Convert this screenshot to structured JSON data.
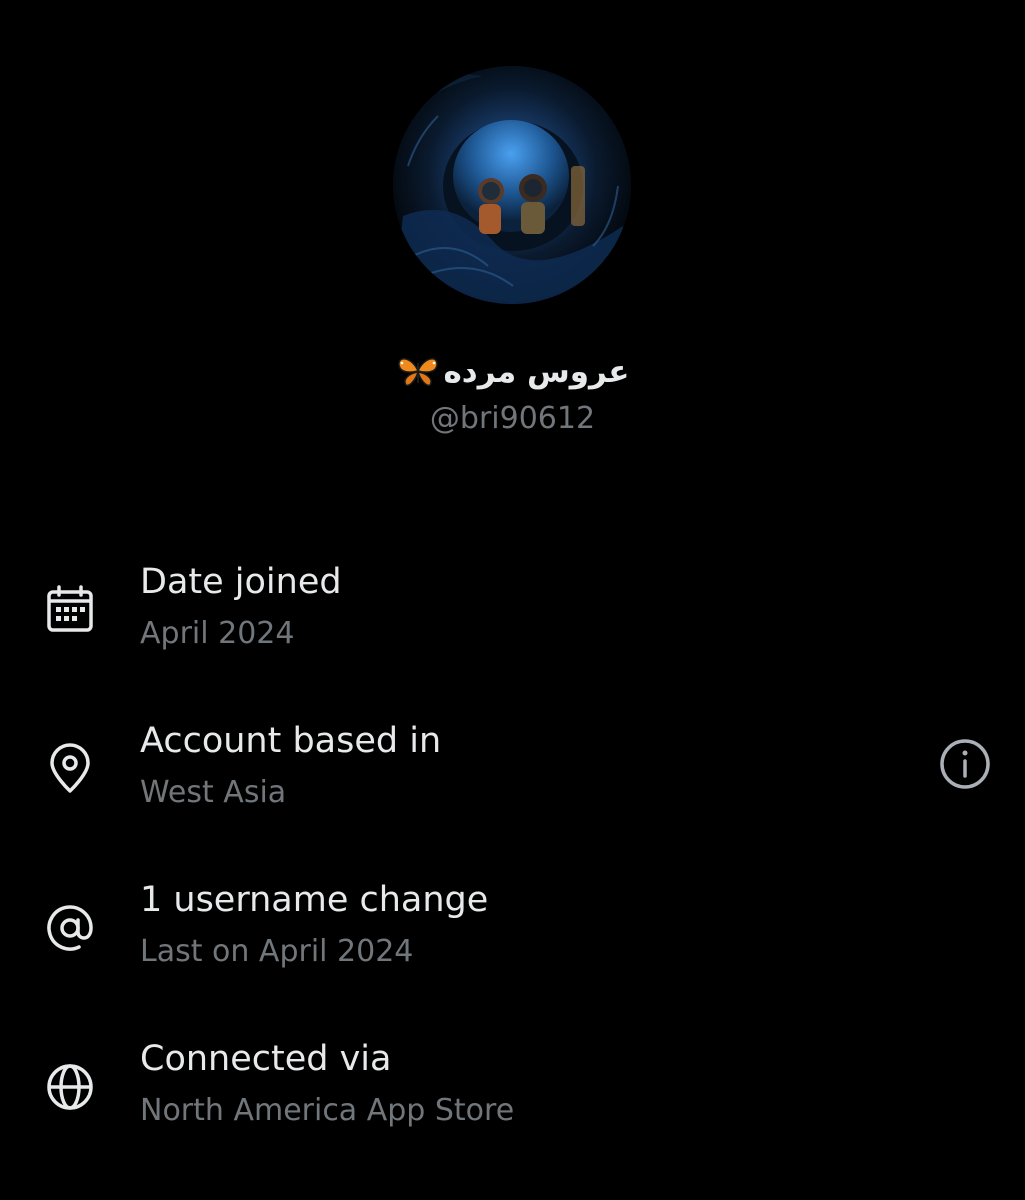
{
  "profile": {
    "display_name": "عروس مرده",
    "display_name_emoji": "butterfly-icon",
    "handle": "@bri90612"
  },
  "details": [
    {
      "icon": "calendar-icon",
      "title": "Date joined",
      "value": "April 2024"
    },
    {
      "icon": "location-pin-icon",
      "title": "Account based in",
      "value": "West Asia",
      "action_icon": "info-icon"
    },
    {
      "icon": "at-sign-icon",
      "title": "1 username change",
      "value": "Last on April 2024"
    },
    {
      "icon": "globe-icon",
      "title": "Connected via",
      "value": "North America App Store"
    }
  ],
  "colors": {
    "background": "#000000",
    "primary_text": "#e7e9ea",
    "secondary_text": "#71767b"
  }
}
